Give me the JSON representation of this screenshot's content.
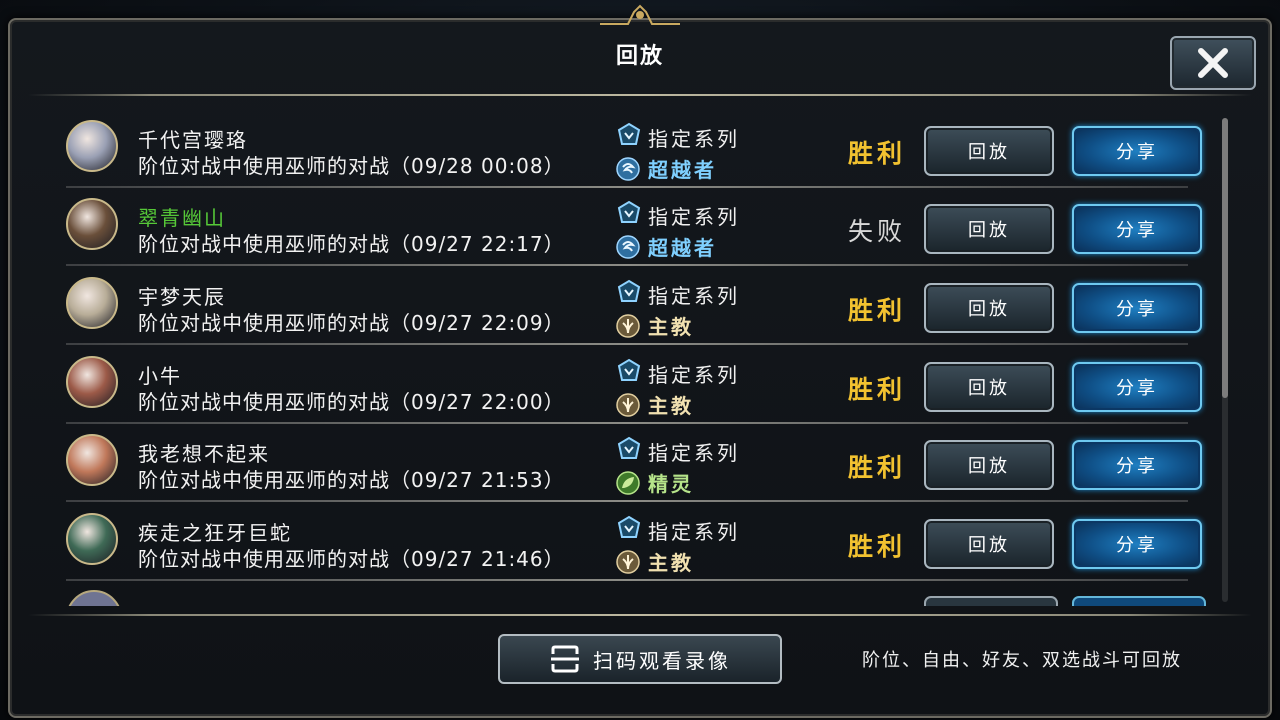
{
  "window": {
    "title": "回放",
    "close_label": "✕"
  },
  "colors": {
    "win": "#f2c230",
    "lose": "#d8d8d8",
    "accent_share": "#1f7fc2",
    "name_highlight": "#56c838"
  },
  "replays": [
    {
      "name": "千代宫璎珞",
      "name_highlight": false,
      "desc": "阶位对战中使用巫师的对战（09/28 00:08）",
      "deck": "指定系列",
      "class": "超越者",
      "class_icon": "wizard-icon",
      "result": "胜利",
      "result_type": "win",
      "avatar_color": "#9aa0b4"
    },
    {
      "name": "翠青幽山",
      "name_highlight": true,
      "desc": "阶位对战中使用巫师的对战（09/27 22:17）",
      "deck": "指定系列",
      "class": "超越者",
      "class_icon": "wizard-icon",
      "result": "失败",
      "result_type": "lose",
      "avatar_color": "#6a4f3a"
    },
    {
      "name": "宇梦天辰",
      "name_highlight": false,
      "desc": "阶位对战中使用巫师的对战（09/27 22:09）",
      "deck": "指定系列",
      "class": "主教",
      "class_icon": "bishop-icon",
      "result": "胜利",
      "result_type": "win",
      "avatar_color": "#b8ad98"
    },
    {
      "name": "小牛",
      "name_highlight": false,
      "desc": "阶位对战中使用巫师的对战（09/27 22:00）",
      "deck": "指定系列",
      "class": "主教",
      "class_icon": "bishop-icon",
      "result": "胜利",
      "result_type": "win",
      "avatar_color": "#9c5a48"
    },
    {
      "name": "我老想不起来",
      "name_highlight": false,
      "desc": "阶位对战中使用巫师的对战（09/27 21:53）",
      "deck": "指定系列",
      "class": "精灵",
      "class_icon": "elf-icon",
      "result": "胜利",
      "result_type": "win",
      "avatar_color": "#c0785a"
    },
    {
      "name": "疾走之狂牙巨蛇",
      "name_highlight": false,
      "desc": "阶位对战中使用巫师的对战（09/27 21:46）",
      "deck": "指定系列",
      "class": "主教",
      "class_icon": "bishop-icon",
      "result": "胜利",
      "result_type": "win",
      "avatar_color": "#3f6a56"
    }
  ],
  "buttons": {
    "replay": "回放",
    "share": "分享"
  },
  "footer": {
    "scan_label": "扫码观看录像",
    "note": "阶位、自由、好友、双选战斗可回放"
  }
}
